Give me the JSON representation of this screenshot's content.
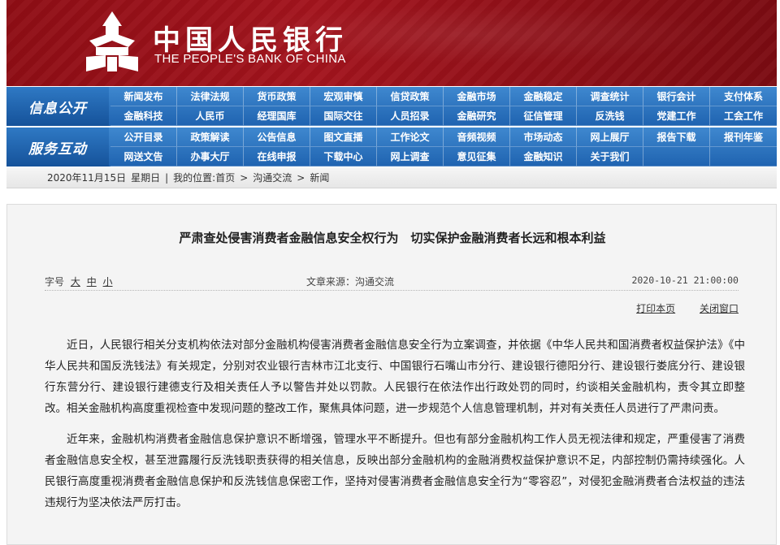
{
  "header": {
    "cn_name": "中国人民银行",
    "en_name": "THE PEOPLE'S BANK OF CHINA",
    "brand_color": "#a3141d"
  },
  "nav": {
    "row1_title": "信息公开",
    "row1_items": [
      "新闻发布",
      "法律法规",
      "货币政策",
      "宏观审慎",
      "信贷政策",
      "金融市场",
      "金融稳定",
      "调查统计",
      "银行会计",
      "支付体系",
      "金融科技",
      "人民币",
      "经理国库",
      "国际交往",
      "人员招录",
      "金融研究",
      "征信管理",
      "反洗钱",
      "党建工作",
      "工会工作"
    ],
    "row2_title": "服务互动",
    "row2_items": [
      "公开目录",
      "政策解读",
      "公告信息",
      "图文直播",
      "工作论文",
      "音频视频",
      "市场动态",
      "网上展厅",
      "报告下载",
      "报刊年鉴",
      "网送文告",
      "办事大厅",
      "在线申报",
      "下载中心",
      "网上调查",
      "意见征集",
      "金融知识",
      "关于我们",
      "",
      ""
    ],
    "accent_color": "#1f63b0"
  },
  "breadcrumb": {
    "date": "2020年11月15日",
    "weekday": "星期日",
    "prefix": "我的位置:",
    "home": "首页",
    "sep": ">",
    "level1": "沟通交流",
    "level2": "新闻"
  },
  "article": {
    "title": "严肃查处侵害消费者金融信息安全权行为　切实保护金融消费者长远和根本利益",
    "font_label": "字号",
    "font_large": "大",
    "font_medium": "中",
    "font_small": "小",
    "source": "文章来源：沟通交流",
    "datetime": "2020-10-21  21:00:00",
    "print_label": "打印本页",
    "close_label": "关闭窗口",
    "paragraph1": "近日，人民银行相关分支机构依法对部分金融机构侵害消费者金融信息安全行为立案调查，并依据《中华人民共和国消费者权益保护法》《中华人民共和国反洗钱法》有关规定，分别对农业银行吉林市江北支行、中国银行石嘴山市分行、建设银行德阳分行、建设银行娄底分行、建设银行东营分行、建设银行建德支行及相关责任人予以警告并处以罚款。人民银行在依法作出行政处罚的同时，约谈相关金融机构，责令其立即整改。相关金融机构高度重视检查中发现问题的整改工作，聚焦具体问题，进一步规范个人信息管理机制，并对有关责任人员进行了严肃问责。",
    "paragraph2": "近年来，金融机构消费者金融信息保护意识不断增强，管理水平不断提升。但也有部分金融机构工作人员无视法律和规定，严重侵害了消费者金融信息安全权，甚至泄露履行反洗钱职责获得的相关信息，反映出部分金融机构的金融消费权益保护意识不足，内部控制仍需持续强化。人民银行高度重视消费者金融信息保护和反洗钱信息保密工作，坚持对侵害消费者金融信息安全行为“零容忍”，对侵犯金融消费者合法权益的违法违规行为坚决依法严厉打击。"
  }
}
